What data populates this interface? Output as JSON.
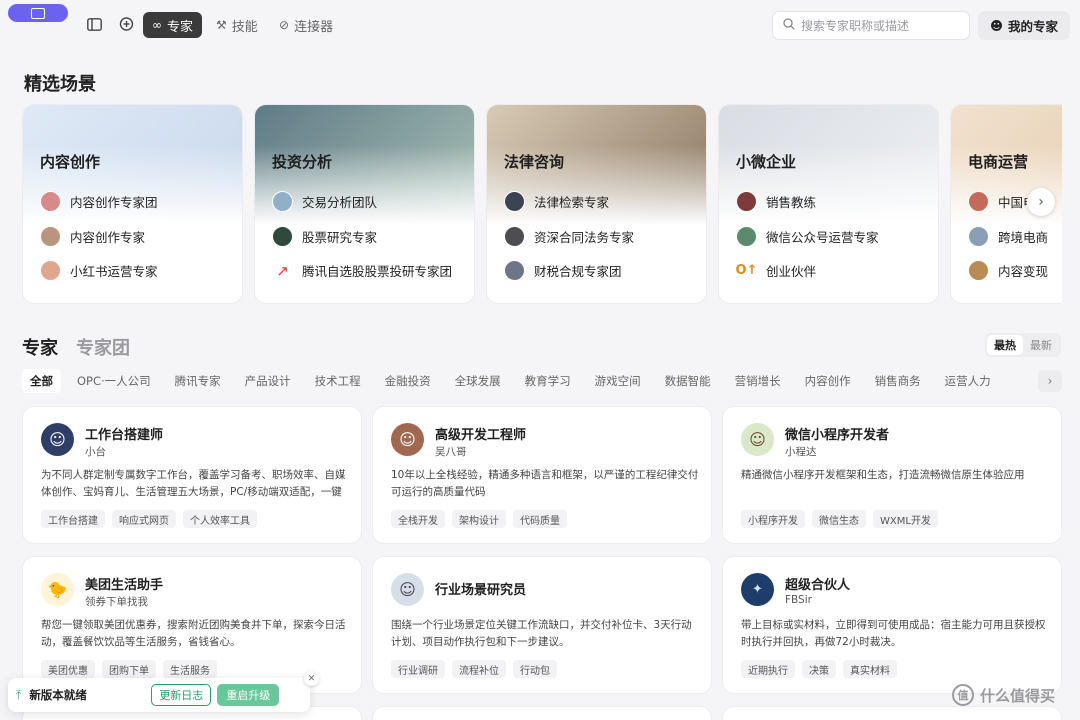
{
  "nav": {
    "tabs": [
      {
        "label": "专家",
        "icon": "infinity-icon"
      },
      {
        "label": "技能",
        "icon": "tools-icon"
      },
      {
        "label": "连接器",
        "icon": "link-icon"
      }
    ],
    "search_placeholder": "搜索专家职称或描述",
    "my_experts": "我的专家"
  },
  "featured": {
    "title": "精选场景",
    "cards": [
      {
        "name": "内容创作",
        "items": [
          "内容创作专家团",
          "内容创作专家",
          "小红书运营专家"
        ]
      },
      {
        "name": "投资分析",
        "items": [
          "交易分析团队",
          "股票研究专家",
          "腾讯自选股股票投研专家团"
        ]
      },
      {
        "name": "法律咨询",
        "items": [
          "法律检索专家",
          "资深合同法务专家",
          "财税合规专家团"
        ]
      },
      {
        "name": "小微企业",
        "items": [
          "销售教练",
          "微信公众号运营专家",
          "创业伙伴"
        ]
      },
      {
        "name": "电商运营",
        "items": [
          "中国电",
          "跨境电商",
          "内容变现"
        ]
      }
    ]
  },
  "experts": {
    "tab_experts": "专家",
    "tab_teams": "专家团",
    "sort_hot": "最热",
    "sort_new": "最新",
    "categories": [
      "全部",
      "OPC·一人公司",
      "腾讯专家",
      "产品设计",
      "技术工程",
      "金融投资",
      "全球发展",
      "教育学习",
      "游戏空间",
      "数据智能",
      "营销增长",
      "内容创作",
      "销售商务",
      "运营人力"
    ],
    "cards": [
      {
        "title": "工作台搭建师",
        "author": "小台",
        "desc": "为不同人群定制专属数字工作台，覆盖学习备考、职场效率、自媒体创作、宝妈育儿、生活管理五大场景，PC/移动端双适配，一键部...",
        "tags": [
          "工作台搭建",
          "响应式网页",
          "个人效率工具"
        ]
      },
      {
        "title": "高级开发工程师",
        "author": "吴八哥",
        "desc": "10年以上全栈经验，精通多种语言和框架，以严谨的工程纪律交付可运行的高质量代码",
        "tags": [
          "全栈开发",
          "架构设计",
          "代码质量"
        ]
      },
      {
        "title": "微信小程序开发者",
        "author": "小程达",
        "desc": "精通微信小程序开发框架和生态，打造流畅微信原生体验应用",
        "tags": [
          "小程序开发",
          "微信生态",
          "WXML开发"
        ]
      },
      {
        "title": "美团生活助手",
        "author": "领券下单找我",
        "desc": "帮您一键领取美团优惠券，搜索附近团购美食并下单，探索今日活动，覆盖餐饮饮品等生活服务，省钱省心。",
        "tags": [
          "美团优惠",
          "团购下单",
          "生活服务"
        ]
      },
      {
        "title": "行业场景研究员",
        "author": "",
        "desc": "围绕一个行业场景定位关键工作流缺口，并交付补位卡、3天行动计划、项目动作执行包和下一步建议。",
        "tags": [
          "行业调研",
          "流程补位",
          "行动包"
        ]
      },
      {
        "title": "超级合伙人",
        "author": "FBSir",
        "desc": "带上目标或实材料，立即得到可使用成品：宿主能力可用且获授权时执行并回执，再做72小时裁决。",
        "tags": [
          "近期执行",
          "决策",
          "真实材料"
        ]
      }
    ]
  },
  "toast": {
    "message": "新版本就绪",
    "changelog": "更新日志",
    "restart": "重启升级"
  },
  "watermark": "什么值得买",
  "colors": {
    "accent_purple": "#6b63f0",
    "success_green": "#22a06b"
  }
}
